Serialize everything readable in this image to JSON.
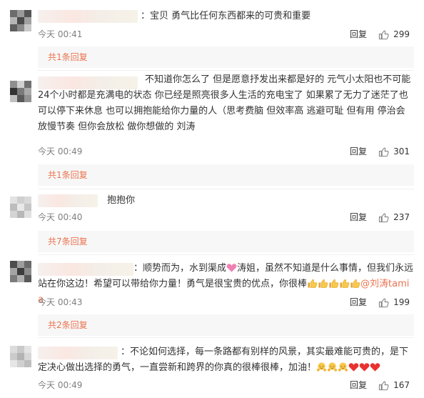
{
  "comments": [
    {
      "text": "：宝贝 勇气比任何东西都来的可贵和重要",
      "time": "今天 00:41",
      "reply_label": "回复",
      "likes": "299",
      "replies_link": "共1条回复"
    },
    {
      "text": "不知道你怎么了 但是愿意抒发出来都是好的 元气小太阳也不可能24个小时都是充满电的状态 你已经是照亮很多人生活的充电宝了 如果累了无力了迷茫了也可以停下来休息 也可以拥抱能给你力量的人（思考费脑 但效率高 逃避可耻 但有用 停治会放慢节奏 但你会放松 做你想做的 刘涛",
      "time": "今天 00:49",
      "reply_label": "回复",
      "likes": "301",
      "replies_link": "共1条回复"
    },
    {
      "text": "抱抱你",
      "time": "今天 00:40",
      "reply_label": "回复",
      "likes": "237",
      "replies_link": "共7条回复"
    },
    {
      "text_before": "：顺势而为，水到渠成",
      "text_middle": "涛姐，虽然不知道是什么事情，但我们永远站在你这边！希望可以带给你力量！勇气是很宝贵的优点，你很棒",
      "mention": "@刘涛tamia",
      "time": "今天 00:43",
      "reply_label": "回复",
      "likes": "199",
      "replies_link": "共2条回复"
    },
    {
      "text": "：不论如何选择，每一条路都有别样的风景，其实最难能可贵的，是下定决心做出选择的勇气，一直尝新和跨界的你真的很棒很棒，加油！",
      "time": "今天 00:49",
      "reply_label": "回复",
      "likes": "167"
    }
  ],
  "colors": {
    "link": "#eb7350",
    "meta": "#808080",
    "text": "#333333",
    "reply_bg": "#f7f7f7"
  },
  "icons": {
    "like": "thumbs-up-icon",
    "emoji_heart": "sparkling-heart-emoji",
    "emoji_thumb": "thumbs-up-emoji",
    "emoji_hug": "hugging-face-emoji",
    "emoji_red_heart": "red-heart-emoji"
  }
}
